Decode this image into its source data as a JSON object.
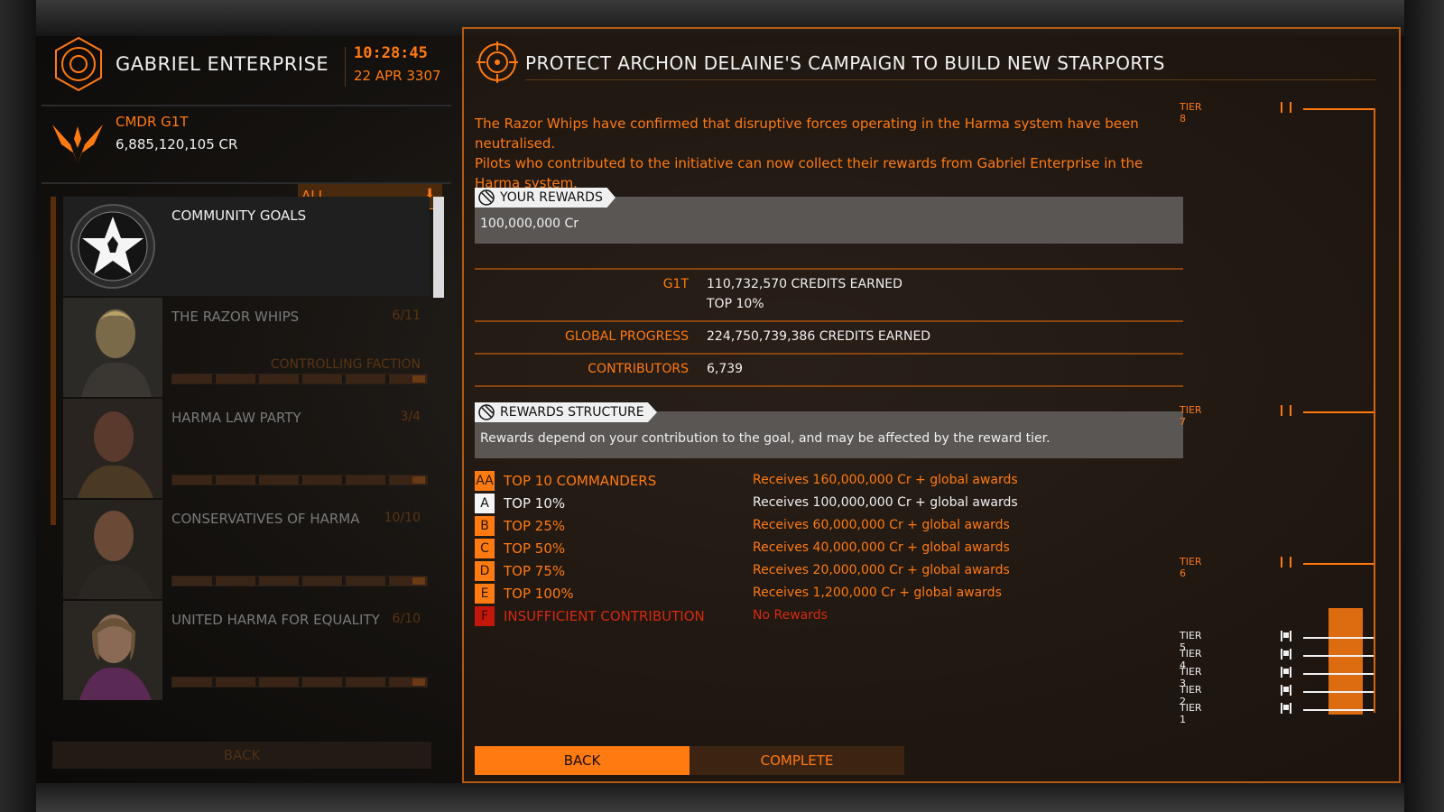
{
  "station": {
    "name": "GABRIEL ENTERPRISE",
    "time": "10:28:45",
    "date": "22 APR 3307"
  },
  "commander": {
    "name": "CMDR G1T",
    "credits": "6,885,120,105 CR"
  },
  "filter": {
    "selected": "ALL",
    "arrow_icon": "down-arrow-icon"
  },
  "goals": [
    {
      "title": "COMMUNITY GOALS",
      "count": "",
      "subtitle": ""
    },
    {
      "title": "THE RAZOR WHIPS",
      "count": "6/11",
      "subtitle": "CONTROLLING FACTION"
    },
    {
      "title": "HARMA LAW PARTY",
      "count": "3/4",
      "subtitle": ""
    },
    {
      "title": "CONSERVATIVES OF HARMA",
      "count": "10/10",
      "subtitle": ""
    },
    {
      "title": "UNITED HARMA FOR EQUALITY",
      "count": "6/10",
      "subtitle": ""
    }
  ],
  "left_back_label": "BACK",
  "mission": {
    "title": "PROTECT ARCHON DELAINE'S CAMPAIGN TO BUILD NEW STARPORTS",
    "description_1": "The Razor Whips have confirmed that disruptive forces operating in the Harma system have been neutralised.",
    "description_2": "Pilots who contributed to the initiative can now collect their rewards from Gabriel Enterprise in the Harma system."
  },
  "rewards": {
    "tag": "YOUR REWARDS",
    "value": "100,000,000 Cr"
  },
  "stats": {
    "player_label": "G1T",
    "player_value_1": "110,732,570 CREDITS EARNED",
    "player_value_2": "TOP 10%",
    "global_label": "GLOBAL PROGRESS",
    "global_value": "224,750,739,386 CREDITS EARNED",
    "contrib_label": "CONTRIBUTORS",
    "contrib_value": "6,739"
  },
  "structure": {
    "tag": "REWARDS STRUCTURE",
    "text": "Rewards depend on your contribution to the goal, and may be affected by the reward tier.",
    "tiers": [
      {
        "letter": "AA",
        "name": "TOP 10 COMMANDERS",
        "reward": "Receives 160,000,000 Cr + global awards"
      },
      {
        "letter": "A",
        "name": "TOP 10%",
        "reward": "Receives 100,000,000 Cr + global awards"
      },
      {
        "letter": "B",
        "name": "TOP 25%",
        "reward": "Receives 60,000,000 Cr + global awards"
      },
      {
        "letter": "C",
        "name": "TOP 50%",
        "reward": "Receives 40,000,000 Cr + global awards"
      },
      {
        "letter": "D",
        "name": "TOP 75%",
        "reward": "Receives 20,000,000 Cr + global awards"
      },
      {
        "letter": "E",
        "name": "TOP 100%",
        "reward": "Receives 1,200,000 Cr + global awards"
      },
      {
        "letter": "F",
        "name": "INSUFFICIENT CONTRIBUTION",
        "reward": "No Rewards"
      }
    ]
  },
  "tier_track": {
    "labels": [
      "TIER 8",
      "TIER 7",
      "TIER 6",
      "TIER 5",
      "TIER 4",
      "TIER 3",
      "TIER 2",
      "TIER 1"
    ],
    "achieved_tiers": 5,
    "accent_color": "#ff7a10"
  },
  "buttons": {
    "back": "BACK",
    "complete": "COMPLETE"
  }
}
